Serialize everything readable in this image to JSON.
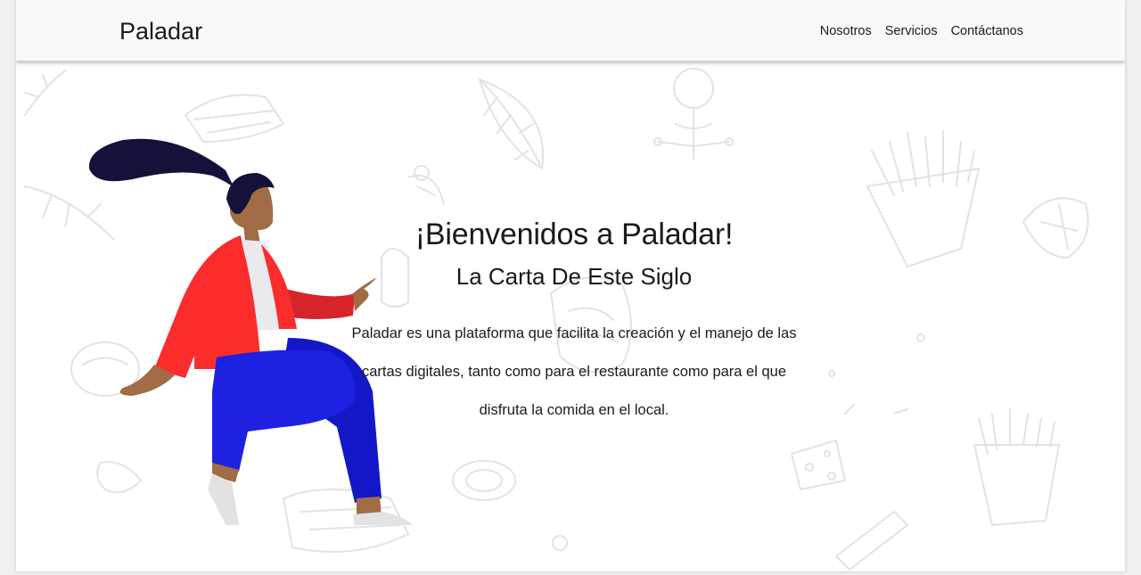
{
  "navbar": {
    "brand": "Paladar",
    "links": [
      "Nosotros",
      "Servicios",
      "Contáctanos"
    ]
  },
  "hero": {
    "title": "¡Bienvenidos a Paladar!",
    "subtitle": "La Carta De Este Siglo",
    "description": "Paladar es una plataforma que facilita la creación y el manejo de las cartas digitales, tanto como para el restaurante como para el que disfruta la comida en el local."
  },
  "colors": {
    "navbar_bg": "#f8f9fa",
    "text": "#1a1a1a",
    "doodle": "#e4e4e4",
    "jacket": "#fb2c2c",
    "pants": "#1e21e0",
    "hair": "#14123a",
    "skin": "#a16b45"
  },
  "icons": [
    "food-doodle-background",
    "woman-illustration"
  ]
}
